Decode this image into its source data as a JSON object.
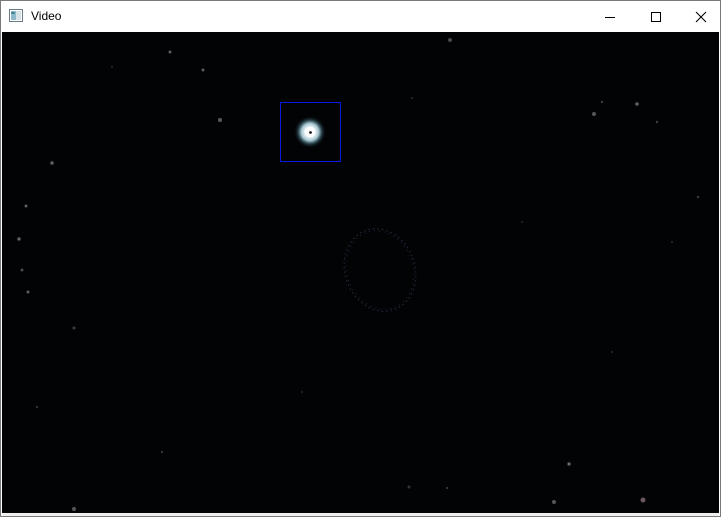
{
  "window": {
    "title": "Video",
    "app_icon": "opencv-window-icon",
    "controls": {
      "minimize_icon": "minimize-icon",
      "maximize_icon": "maximize-icon",
      "close_icon": "close-icon"
    }
  },
  "video": {
    "frame_background": "#020304",
    "tracking_box_color": "#0a1adb",
    "bright_star_color": "#ffffff"
  }
}
